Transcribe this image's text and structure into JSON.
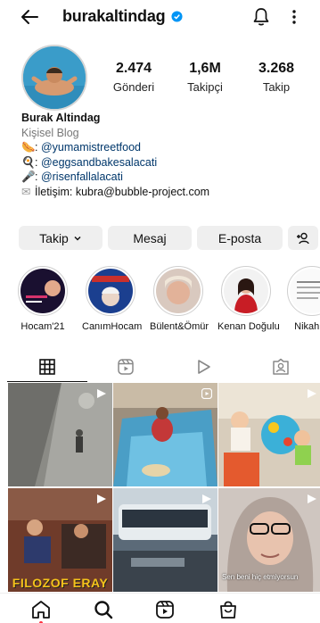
{
  "header": {
    "username": "burakaltindag",
    "icons": [
      "back-arrow-icon",
      "verified-badge-icon",
      "bell-icon",
      "more-vertical-icon"
    ]
  },
  "profile": {
    "stats": [
      {
        "value": "2.474",
        "label": "Gönderi"
      },
      {
        "value": "1,6M",
        "label": "Takipçi"
      },
      {
        "value": "3.268",
        "label": "Takip"
      }
    ],
    "display_name": "Burak Altindag",
    "category": "Kişisel Blog",
    "bio_lines": [
      {
        "emoji": "🌭",
        "prefix": ": ",
        "link": "@yumamistreetfood"
      },
      {
        "emoji": "🍳",
        "prefix": ": ",
        "link": "@eggsandbakesalacati"
      },
      {
        "emoji": "🎤",
        "prefix": ": ",
        "link": "@risenfallalacati"
      }
    ],
    "contact": {
      "emoji": "✉",
      "text": "İletişim: kubra@bubble-project.com"
    }
  },
  "actions": {
    "follow": "Takip",
    "message": "Mesaj",
    "email": "E-posta"
  },
  "highlights": [
    {
      "label": "Hocam'21"
    },
    {
      "label": "CanımHocam"
    },
    {
      "label": "Bülent&Ömür"
    },
    {
      "label": "Kenan Doğulu"
    },
    {
      "label": "Nikah G"
    }
  ],
  "tabs": [
    "grid-icon",
    "reels-icon",
    "play-icon",
    "tagged-icon"
  ],
  "posts": [
    {
      "caption": ""
    },
    {
      "caption": ""
    },
    {
      "caption": ""
    },
    {
      "caption": "FILOZOF ERAY"
    },
    {
      "caption": ""
    },
    {
      "caption": "Sen beni hiç etmiyorsun"
    }
  ],
  "colors": {
    "link": "#00376b",
    "verified": "#0095f6",
    "button_bg": "#efefef",
    "notification_dot": "#ff3040"
  }
}
